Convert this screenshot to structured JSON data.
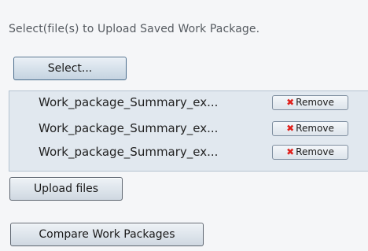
{
  "instruction": "Select(file(s) to Upload Saved Work Package.",
  "select_button": "Select...",
  "files": [
    {
      "name": "Work_package_Summary_ex...",
      "remove_label": "Remove",
      "remove_icon": "x-mark-icon"
    },
    {
      "name": "Work_package_Summary_ex...",
      "remove_label": "Remove",
      "remove_icon": "x-mark-icon"
    },
    {
      "name": "Work_package_Summary_ex...",
      "remove_label": "Remove",
      "remove_icon": "x-mark-icon"
    }
  ],
  "upload_button": "Upload files",
  "compare_button": "Compare Work Packages",
  "colors": {
    "remove_icon": "#e0211c",
    "file_area_background": "#e1e8ef",
    "panel_background": "#f5f6f8"
  }
}
